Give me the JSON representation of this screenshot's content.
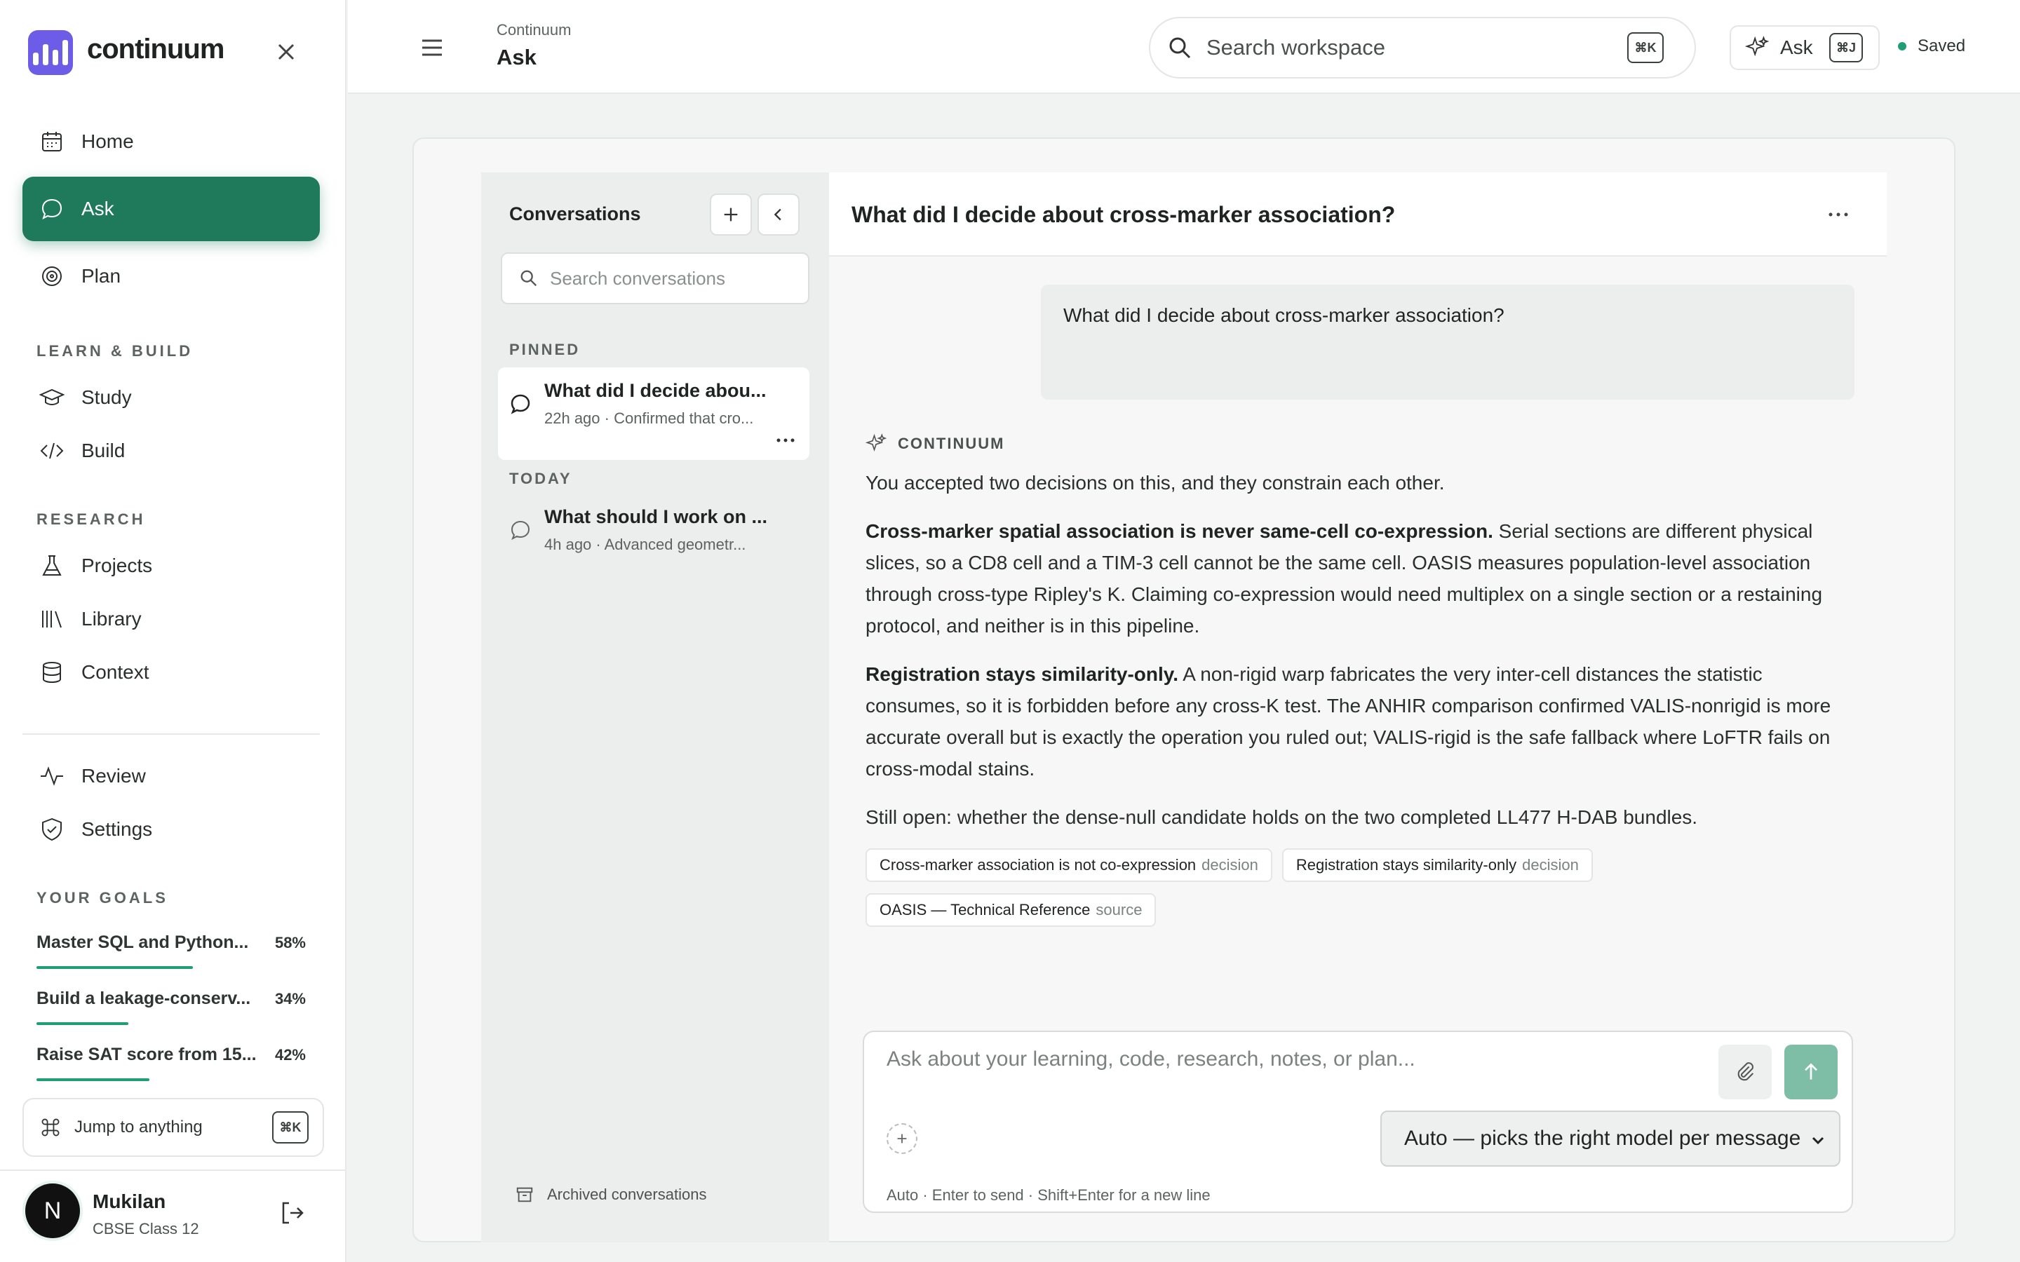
{
  "brand": "continuum",
  "nav": {
    "home": "Home",
    "ask": "Ask",
    "plan": "Plan",
    "learn_header": "LEARN & BUILD",
    "study": "Study",
    "build": "Build",
    "research_header": "RESEARCH",
    "projects": "Projects",
    "library": "Library",
    "context": "Context",
    "review": "Review",
    "settings": "Settings"
  },
  "goals": {
    "header": "YOUR GOALS",
    "items": [
      {
        "title": "Master SQL and Python...",
        "pct": "58%",
        "progress": 0.58
      },
      {
        "title": "Build a leakage-conserv...",
        "pct": "34%",
        "progress": 0.34
      },
      {
        "title": "Raise SAT score from 15...",
        "pct": "42%",
        "progress": 0.42
      }
    ]
  },
  "jump": {
    "label": "Jump to anything",
    "kbd": "⌘K"
  },
  "user": {
    "initial": "N",
    "name": "Mukilan",
    "sub": "CBSE Class 12"
  },
  "topbar": {
    "crumb": "Continuum",
    "title": "Ask",
    "search_placeholder": "Search workspace",
    "search_kbd": "⌘K",
    "ask_label": "Ask",
    "ask_kbd": "⌘J",
    "saved": "Saved"
  },
  "conversations": {
    "title": "Conversations",
    "search_placeholder": "Search conversations",
    "pinned_label": "PINNED",
    "today_label": "TODAY",
    "pinned": [
      {
        "title": "What did I decide abou...",
        "sub": "22h ago · Confirmed that cro..."
      }
    ],
    "today": [
      {
        "title": "What should I work on ...",
        "sub": "4h ago · Advanced geometr..."
      }
    ],
    "archived": "Archived conversations"
  },
  "chat": {
    "title": "What did I decide about cross-marker association?",
    "question": "What did I decide about cross-marker association?",
    "role": "CONTINUUM",
    "intro": "You accepted two decisions on this, and they constrain each other.",
    "p1_bold": "Cross-marker spatial association is never same-cell co-expression.",
    "p1_text": " Serial sections are different physical slices, so a CD8 cell and a TIM-3 cell cannot be the same cell. OASIS measures population-level association through cross-type Ripley's K. Claiming co-expression would need multiplex on a single section or a restaining protocol, and neither is in this pipeline.",
    "p2_bold": "Registration stays similarity-only.",
    "p2_text": " A non-rigid warp fabricates the very inter-cell distances the statistic consumes, so it is forbidden before any cross-K test. The ANHIR comparison confirmed VALIS-nonrigid is more accurate overall but is exactly the operation you ruled out; VALIS-rigid is the safe fallback where LoFTR fails on cross-modal stains.",
    "p3": "Still open: whether the dense-null candidate holds on the two completed LL477 H-DAB bundles.",
    "chips": [
      {
        "label": "Cross-marker association is not co-expression",
        "kind": "decision"
      },
      {
        "label": "Registration stays similarity-only",
        "kind": "decision"
      },
      {
        "label": "OASIS — Technical Reference",
        "kind": "source"
      }
    ]
  },
  "composer": {
    "placeholder": "Ask about your learning, code, research, notes, or plan...",
    "model": "Auto — picks the right model per message",
    "hint": "Auto · Enter to send · Shift+Enter for a new line"
  }
}
